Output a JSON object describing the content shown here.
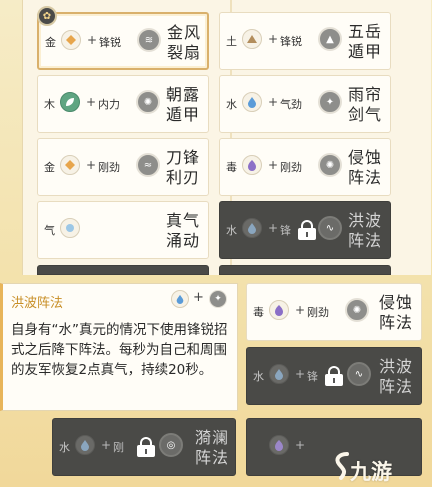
{
  "selected_badge_icon": "flower-icon",
  "tooltip": {
    "title": "洪波阵法",
    "element_icon": "water-drop-icon",
    "plus": "+",
    "attack_icon": "sharp-strike-icon",
    "description": "自身有“水”真元的情况下使用锋锐招式之后降下阵法。每秒为自己和周围的友军恢复2点真气，持续20秒。"
  },
  "cards": {
    "c1": {
      "element": "金",
      "element_icon": "metal-icon",
      "plus": "+",
      "attack": "锋锐",
      "skill_icon": "wind-icon",
      "title": "金风裂扇"
    },
    "c2": {
      "element": "土",
      "element_icon": "earth-icon",
      "plus": "+",
      "attack": "锋锐",
      "skill_icon": "mountain-icon",
      "title": "五岳遁甲"
    },
    "c3": {
      "element": "木",
      "element_icon": "wood-leaf-icon",
      "plus": "+",
      "attack": "内力",
      "skill_icon": "swirl-icon",
      "title": "朝露遁甲"
    },
    "c4": {
      "element": "水",
      "element_icon": "water-drop-icon",
      "plus": "+",
      "attack": "气劲",
      "skill_icon": "sword-icon",
      "title": "雨帘剑气"
    },
    "c5": {
      "element": "金",
      "element_icon": "metal-icon",
      "plus": "+",
      "attack": "刚劲",
      "skill_icon": "wind-blade-icon",
      "title": "刀锋利刃"
    },
    "c6": {
      "element": "毒",
      "element_icon": "poison-icon",
      "plus": "+",
      "attack": "刚劲",
      "skill_icon": "swirl-icon",
      "title": "侵蚀阵法"
    },
    "c7": {
      "element": "气",
      "element_icon": "qi-icon",
      "plus": "+",
      "attack": "",
      "skill_icon": "",
      "title": "真气涌动"
    },
    "c8": {
      "element": "水",
      "element_icon": "water-drop-icon",
      "plus": "+",
      "attack": "锋",
      "skill_icon": "wave-icon",
      "title": "洪波阵法"
    },
    "c9": {
      "element": "毒",
      "element_icon": "poison-icon",
      "plus": "+",
      "attack": "刚劲",
      "skill_icon": "swirl-icon",
      "title": "侵蚀阵法"
    },
    "c10": {
      "element": "水",
      "element_icon": "water-drop-icon",
      "plus": "+",
      "attack": "锋",
      "skill_icon": "wave-icon",
      "title": "洪波阵法"
    },
    "c11": {
      "element": "水",
      "element_icon": "water-drop-icon",
      "plus": "+",
      "attack": "刚",
      "skill_icon": "whirlpool-icon",
      "title": "漪澜阵法"
    },
    "c12": {
      "element": "",
      "element_icon": "poison-icon",
      "plus": "+",
      "attack": "",
      "skill_icon": "",
      "title": ""
    }
  },
  "watermark": "九游",
  "colors": {
    "accent": "#c88f27",
    "selected_border": "#d9b06b",
    "dark_card": "#4a4a47"
  }
}
